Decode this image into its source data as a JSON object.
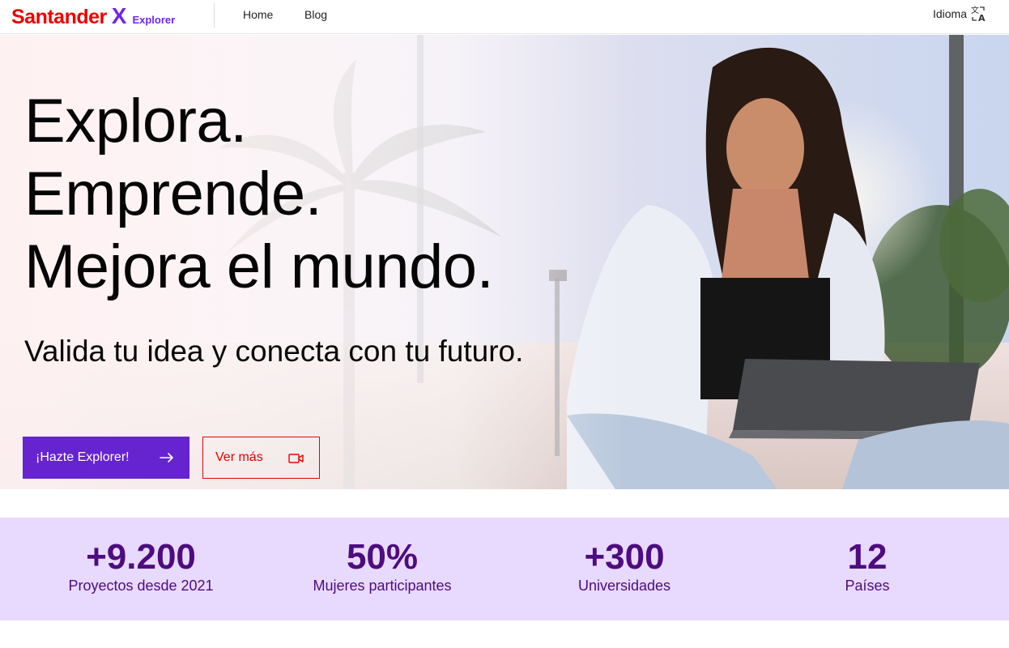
{
  "header": {
    "logo_word": "Santander",
    "logo_x": "X",
    "logo_sub": "Explorer",
    "nav": {
      "home": "Home",
      "blog": "Blog"
    },
    "language_label": "Idioma",
    "language_icon": "translate-icon"
  },
  "hero": {
    "headline": [
      "Explora.",
      "Emprende.",
      "Mejora el mundo."
    ],
    "subheadline": "Valida tu idea y conecta con tu futuro.",
    "primary_button": {
      "label": "¡Hazte Explorer!",
      "icon": "arrow-right-icon"
    },
    "secondary_button": {
      "label": "Ver más",
      "icon": "video-camera-icon"
    }
  },
  "stats": [
    {
      "value": "+9.200",
      "label": "Proyectos desde 2021"
    },
    {
      "value": "50%",
      "label": "Mujeres participantes"
    },
    {
      "value": "+300",
      "label": "Universidades"
    },
    {
      "value": "12",
      "label": "Países"
    }
  ],
  "colors": {
    "brand_red": "#ec0000",
    "brand_purple": "#6623d0",
    "stats_bg": "#e8d9ff",
    "stats_text": "#4d0c7f"
  }
}
